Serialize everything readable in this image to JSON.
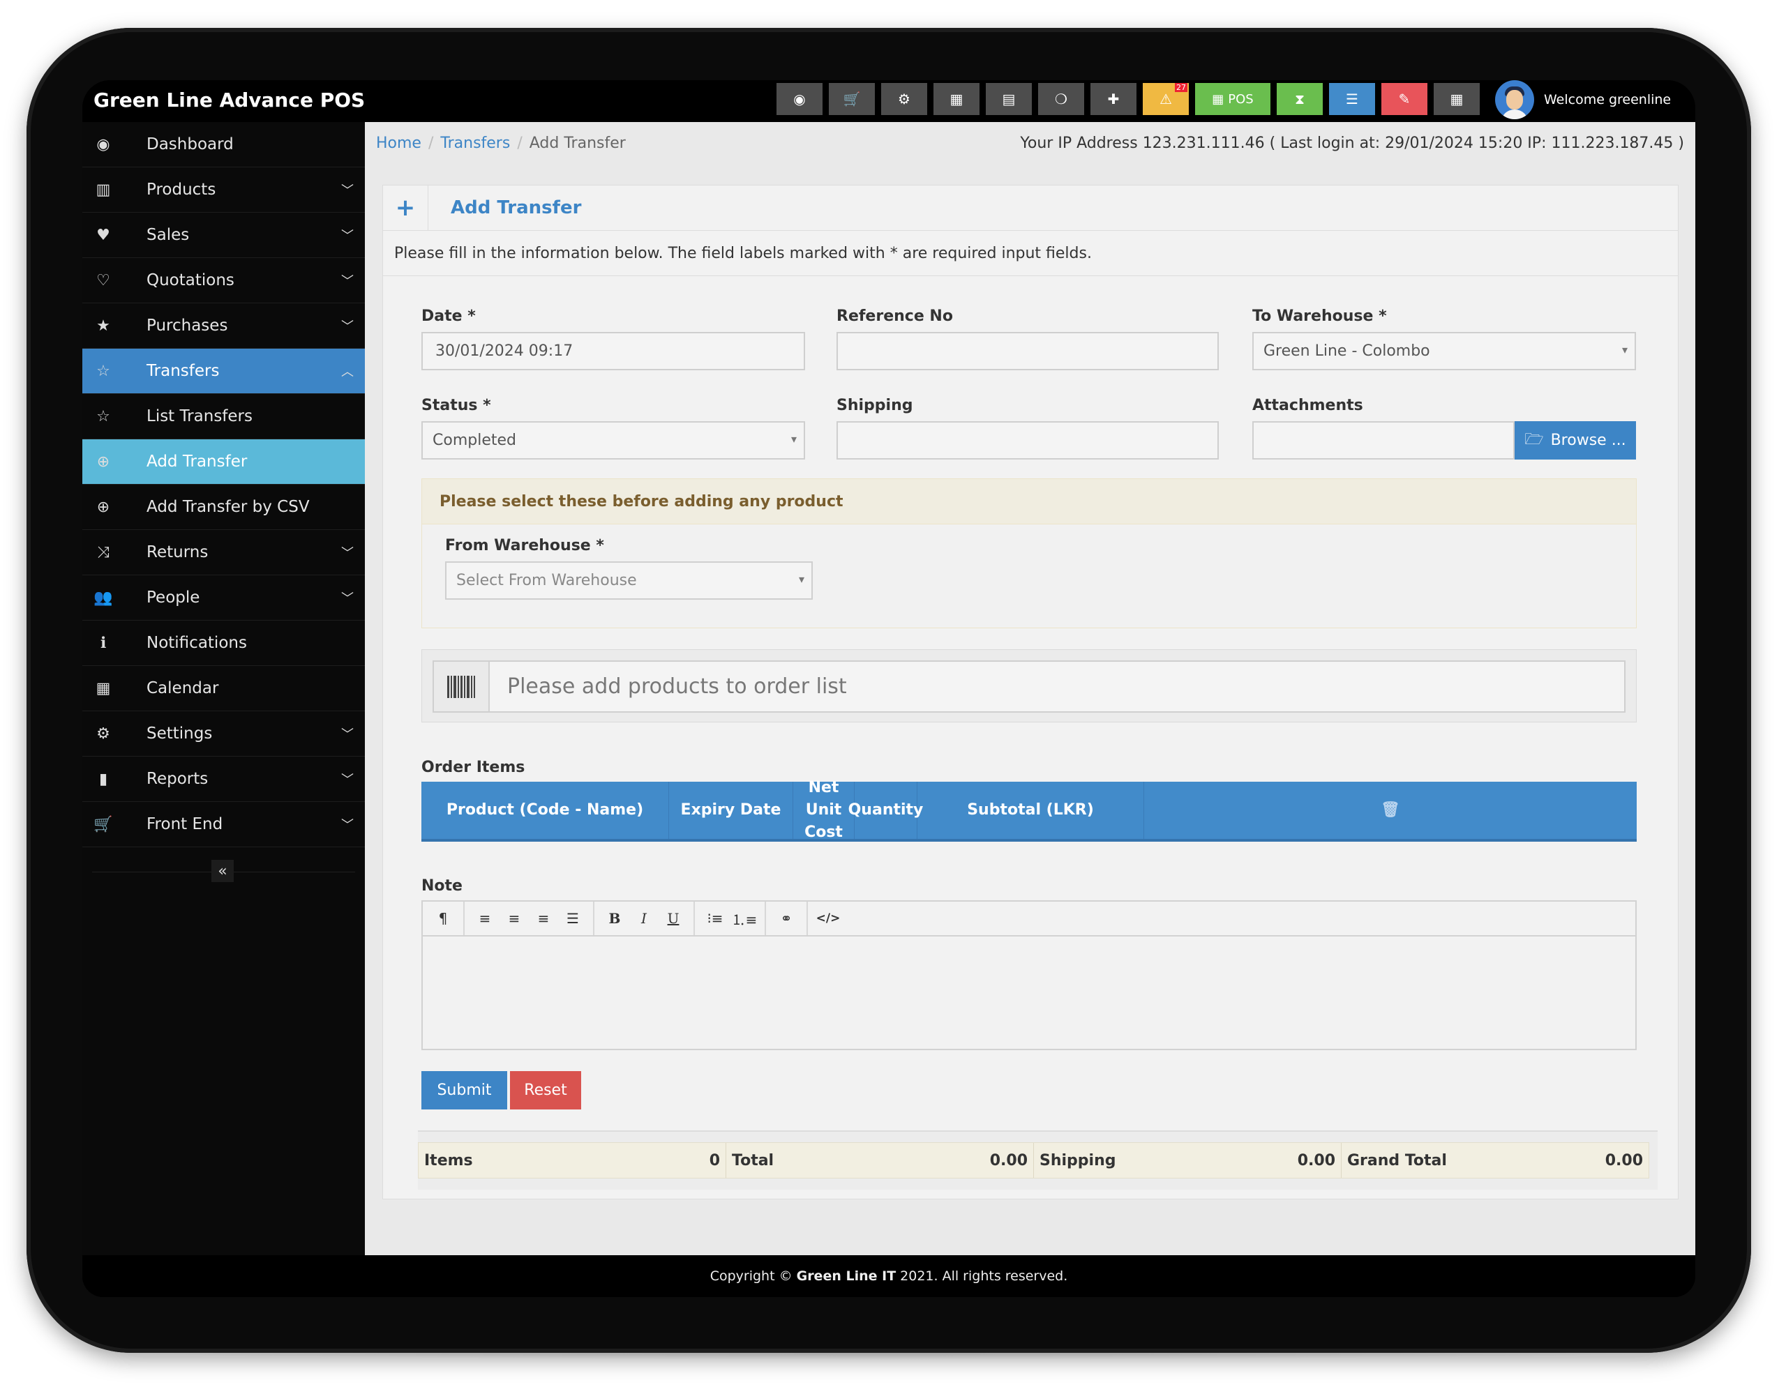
{
  "app": {
    "title": "Green Line Advance POS"
  },
  "toolbar": {
    "buttons": [
      {
        "icon": "dashboard-icon",
        "glyph": "◉",
        "color": "#4d4d4d"
      },
      {
        "icon": "cart-icon",
        "glyph": "🛒",
        "color": "#4d4d4d"
      },
      {
        "icon": "settings-icon",
        "glyph": "⚙",
        "color": "#4d4d4d"
      },
      {
        "icon": "calculator-icon",
        "glyph": "▦",
        "color": "#4d4d4d"
      },
      {
        "icon": "calendar-icon",
        "glyph": "▤",
        "color": "#4d4d4d"
      },
      {
        "icon": "html5-icon",
        "glyph": "❍",
        "color": "#4d4d4d"
      },
      {
        "icon": "uk-flag-icon",
        "glyph": "✚",
        "color": "#4d4d4d"
      },
      {
        "icon": "alert-icon",
        "glyph": "⚠",
        "color": "#f0b942",
        "badge": "27"
      },
      {
        "icon": "pos-icon",
        "glyph": "▦",
        "label": "POS",
        "color": "#6abe4e"
      },
      {
        "icon": "hourglass-icon",
        "glyph": "⧗",
        "color": "#6abe4e"
      },
      {
        "icon": "list-icon",
        "glyph": "☰",
        "color": "#428bca"
      },
      {
        "icon": "eraser-icon",
        "glyph": "✎",
        "color": "#e8545a"
      },
      {
        "icon": "grid-icon",
        "glyph": "▦",
        "color": "#4d4d4d"
      }
    ],
    "welcome": "Welcome greenline"
  },
  "sidebar": {
    "items": [
      {
        "label": "Dashboard",
        "icon": "dashboard-icon",
        "glyph": "◉",
        "chevron": false,
        "state": ""
      },
      {
        "label": "Products",
        "icon": "barcode-icon",
        "glyph": "▥",
        "chevron": true,
        "state": ""
      },
      {
        "label": "Sales",
        "icon": "heart-icon",
        "glyph": "♥",
        "chevron": true,
        "state": ""
      },
      {
        "label": "Quotations",
        "icon": "heart-outline-icon",
        "glyph": "♡",
        "chevron": true,
        "state": ""
      },
      {
        "label": "Purchases",
        "icon": "star-icon",
        "glyph": "★",
        "chevron": true,
        "state": ""
      },
      {
        "label": "Transfers",
        "icon": "star-outline-icon",
        "glyph": "☆",
        "chevron": true,
        "state": "active",
        "expanded": true
      },
      {
        "label": "List Transfers",
        "icon": "star-outline-icon",
        "glyph": "☆",
        "chevron": false,
        "state": ""
      },
      {
        "label": "Add Transfer",
        "icon": "plus-circle-icon",
        "glyph": "⊕",
        "chevron": false,
        "state": "sub-active"
      },
      {
        "label": "Add Transfer by CSV",
        "icon": "plus-circle-icon",
        "glyph": "⊕",
        "chevron": false,
        "state": ""
      },
      {
        "label": "Returns",
        "icon": "shuffle-icon",
        "glyph": "⤨",
        "chevron": true,
        "state": ""
      },
      {
        "label": "People",
        "icon": "users-icon",
        "glyph": "👥",
        "chevron": true,
        "state": ""
      },
      {
        "label": "Notifications",
        "icon": "info-icon",
        "glyph": "ℹ",
        "chevron": false,
        "state": ""
      },
      {
        "label": "Calendar",
        "icon": "calendar-icon",
        "glyph": "▦",
        "chevron": false,
        "state": ""
      },
      {
        "label": "Settings",
        "icon": "cog-icon",
        "glyph": "⚙",
        "chevron": true,
        "state": ""
      },
      {
        "label": "Reports",
        "icon": "bar-chart-icon",
        "glyph": "▮",
        "chevron": true,
        "state": ""
      },
      {
        "label": "Front End",
        "icon": "cart-icon",
        "glyph": "🛒",
        "chevron": true,
        "state": ""
      }
    ],
    "collapse_glyph": "«"
  },
  "breadcrumb": {
    "home": "Home",
    "parent": "Transfers",
    "current": "Add Transfer"
  },
  "ip_info": "Your IP Address 123.231.111.46 ( Last login at: 29/01/2024 15:20 IP: 111.223.187.45 )",
  "form": {
    "title": "Add Transfer",
    "intro": "Please fill in the information below. The field labels marked with * are required input fields.",
    "date": {
      "label": "Date *",
      "value": "30/01/2024 09:17"
    },
    "reference": {
      "label": "Reference No",
      "value": ""
    },
    "to_warehouse": {
      "label": "To Warehouse *",
      "value": "Green Line - Colombo"
    },
    "status": {
      "label": "Status *",
      "value": "Completed"
    },
    "shipping": {
      "label": "Shipping",
      "value": ""
    },
    "attachments": {
      "label": "Attachments",
      "browse": "Browse ..."
    },
    "warning": "Please select these before adding any product",
    "from_warehouse": {
      "label": "From Warehouse *",
      "placeholder": "Select From Warehouse"
    },
    "add_product_placeholder": "Please add products to order list",
    "order_items_label": "Order Items",
    "order_columns": [
      "Product (Code - Name)",
      "Expiry Date",
      "Net Unit Cost",
      "Quantity",
      "Subtotal (LKR)"
    ],
    "note_label": "Note",
    "editor_tools": [
      [
        "paragraph"
      ],
      [
        "align-left",
        "align-center",
        "align-right",
        "justify"
      ],
      [
        "bold",
        "italic",
        "underline"
      ],
      [
        "unordered-list",
        "ordered-list"
      ],
      [
        "link"
      ],
      [
        "code"
      ]
    ],
    "submit": "Submit",
    "reset": "Reset"
  },
  "totals": {
    "items_label": "Items",
    "items": "0",
    "total_label": "Total",
    "total": "0.00",
    "shipping_label": "Shipping",
    "shipping": "0.00",
    "grand_total_label": "Grand Total",
    "grand_total": "0.00"
  },
  "footer": {
    "prefix": "Copyright ©",
    "company": "Green Line IT",
    "suffix": "2021. All rights reserved."
  }
}
